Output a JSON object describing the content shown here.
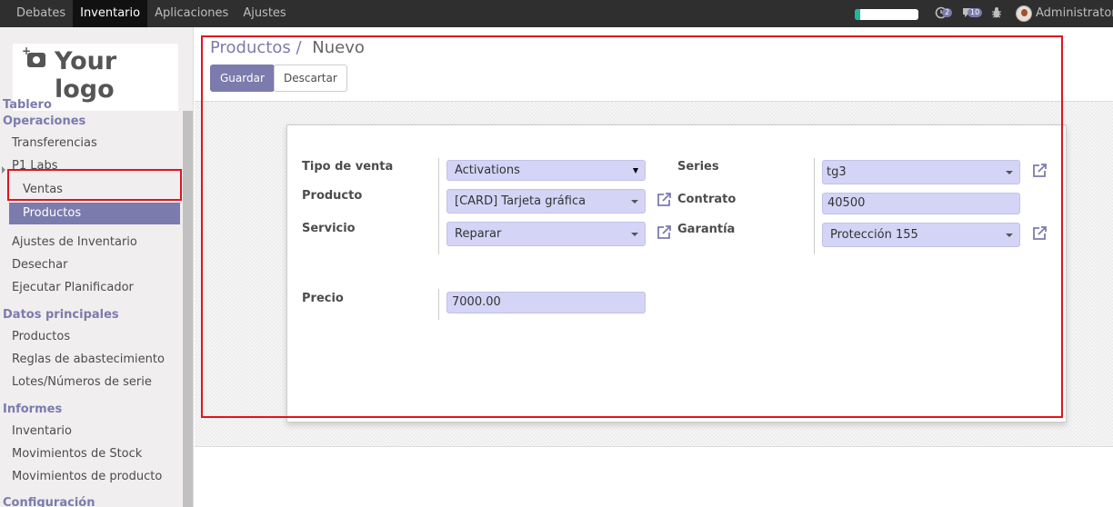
{
  "topbar": {
    "menu": [
      "Debates",
      "Inventario",
      "Aplicaciones",
      "Ajustes"
    ],
    "active_menu": "Inventario",
    "badge_activity": "2",
    "badge_messages": "10",
    "user": "Administrator (",
    "progress_fraction": 0.08,
    "progress_color": "#21b799"
  },
  "sidebar": {
    "logo_text": "Your logo",
    "tablero": "Tablero",
    "operaciones": "Operaciones",
    "transferencias": "Transferencias",
    "p1labs": "P1 Labs",
    "ventas": "Ventas",
    "productos_active": "Productos",
    "ajustes_inventario": "Ajustes de Inventario",
    "desechar": "Desechar",
    "planificador": "Ejecutar Planificador",
    "datos_principales": "Datos principales",
    "productos": "Productos",
    "reglas": "Reglas de abastecimiento",
    "lotes": "Lotes/Números de serie",
    "informes": "Informes",
    "inventario": "Inventario",
    "mov_stock": "Movimientos de Stock",
    "mov_producto": "Movimientos de producto",
    "configuracion": "Configuración"
  },
  "breadcrumb": {
    "parent": "Productos",
    "separator": "/",
    "current": "Nuevo"
  },
  "buttons": {
    "save": "Guardar",
    "discard": "Descartar"
  },
  "form": {
    "tipo_venta_label": "Tipo de venta",
    "tipo_venta_value": "Activations",
    "producto_label": "Producto",
    "producto_value": "[CARD] Tarjeta gráfica",
    "servicio_label": "Servicio",
    "servicio_value": "Reparar",
    "series_label": "Series",
    "series_value": "tg3",
    "contrato_label": "Contrato",
    "contrato_value": "40500",
    "garantia_label": "Garantía",
    "garantia_value": "Protección 155",
    "precio_label": "Precio",
    "precio_value": "7000.00"
  },
  "colors": {
    "accent": "#7c7bad",
    "field_bg": "#d4d4f7",
    "highlight": "#e0141e"
  }
}
